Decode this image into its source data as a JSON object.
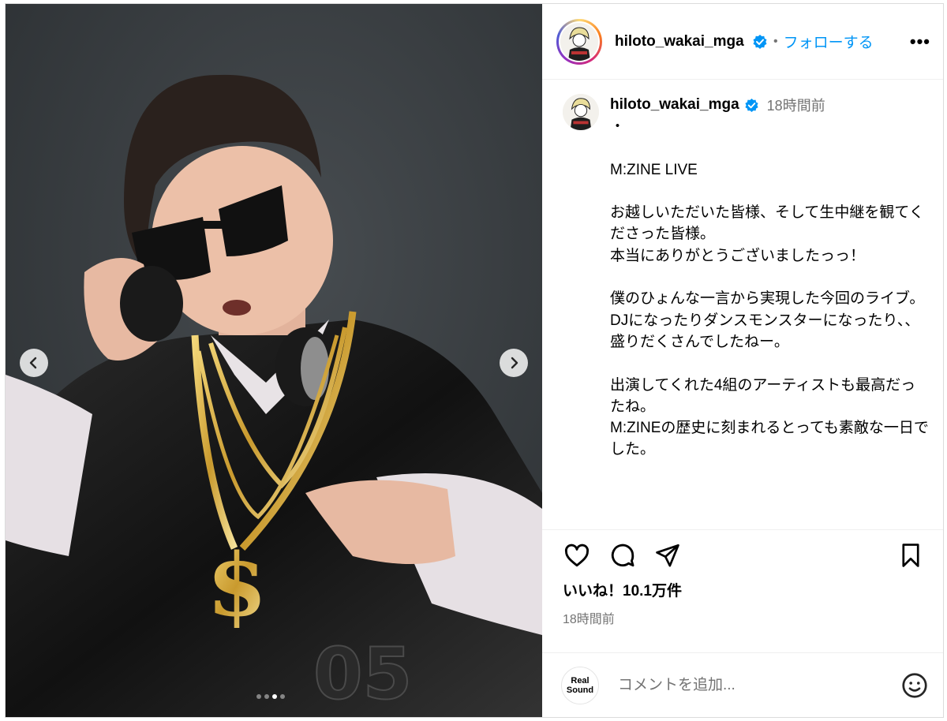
{
  "header": {
    "username": "hiloto_wakai_mga",
    "separator": "•",
    "follow_label": "フォローする",
    "more_label": "•••"
  },
  "post": {
    "username": "hiloto_wakai_mga",
    "time": "18時間前",
    "caption": "・\n\nM:ZINE LIVE\n\nお越しいただいた皆様、そして生中継を観てくださった皆様。\n本当にありがとうございましたっっ！\n\n僕のひょんな一言から実現した今回のライブ。\nDJになったりダンスモンスターになったり、、\n盛りだくさんでしたねー。\n\n出演してくれた4組のアーティストも最高だったね。\nM:ZINEの歴史に刻まれるとっても素敵な一日でした。"
  },
  "stats": {
    "likes": "いいね！10.1万件",
    "posted": "18時間前"
  },
  "comment_box": {
    "logo_line1": "Real",
    "logo_line2": "Sound",
    "placeholder": "コメントを追加..."
  },
  "carousel": {
    "slide_count": 4,
    "active_index": 2
  },
  "colors": {
    "accent": "#0095f6",
    "verified": "#0095f6",
    "muted": "#737373"
  },
  "icons": [
    "heart-icon",
    "comment-icon",
    "share-icon",
    "bookmark-icon",
    "emoji-icon",
    "verified-icon",
    "chevron-left-icon",
    "chevron-right-icon"
  ]
}
